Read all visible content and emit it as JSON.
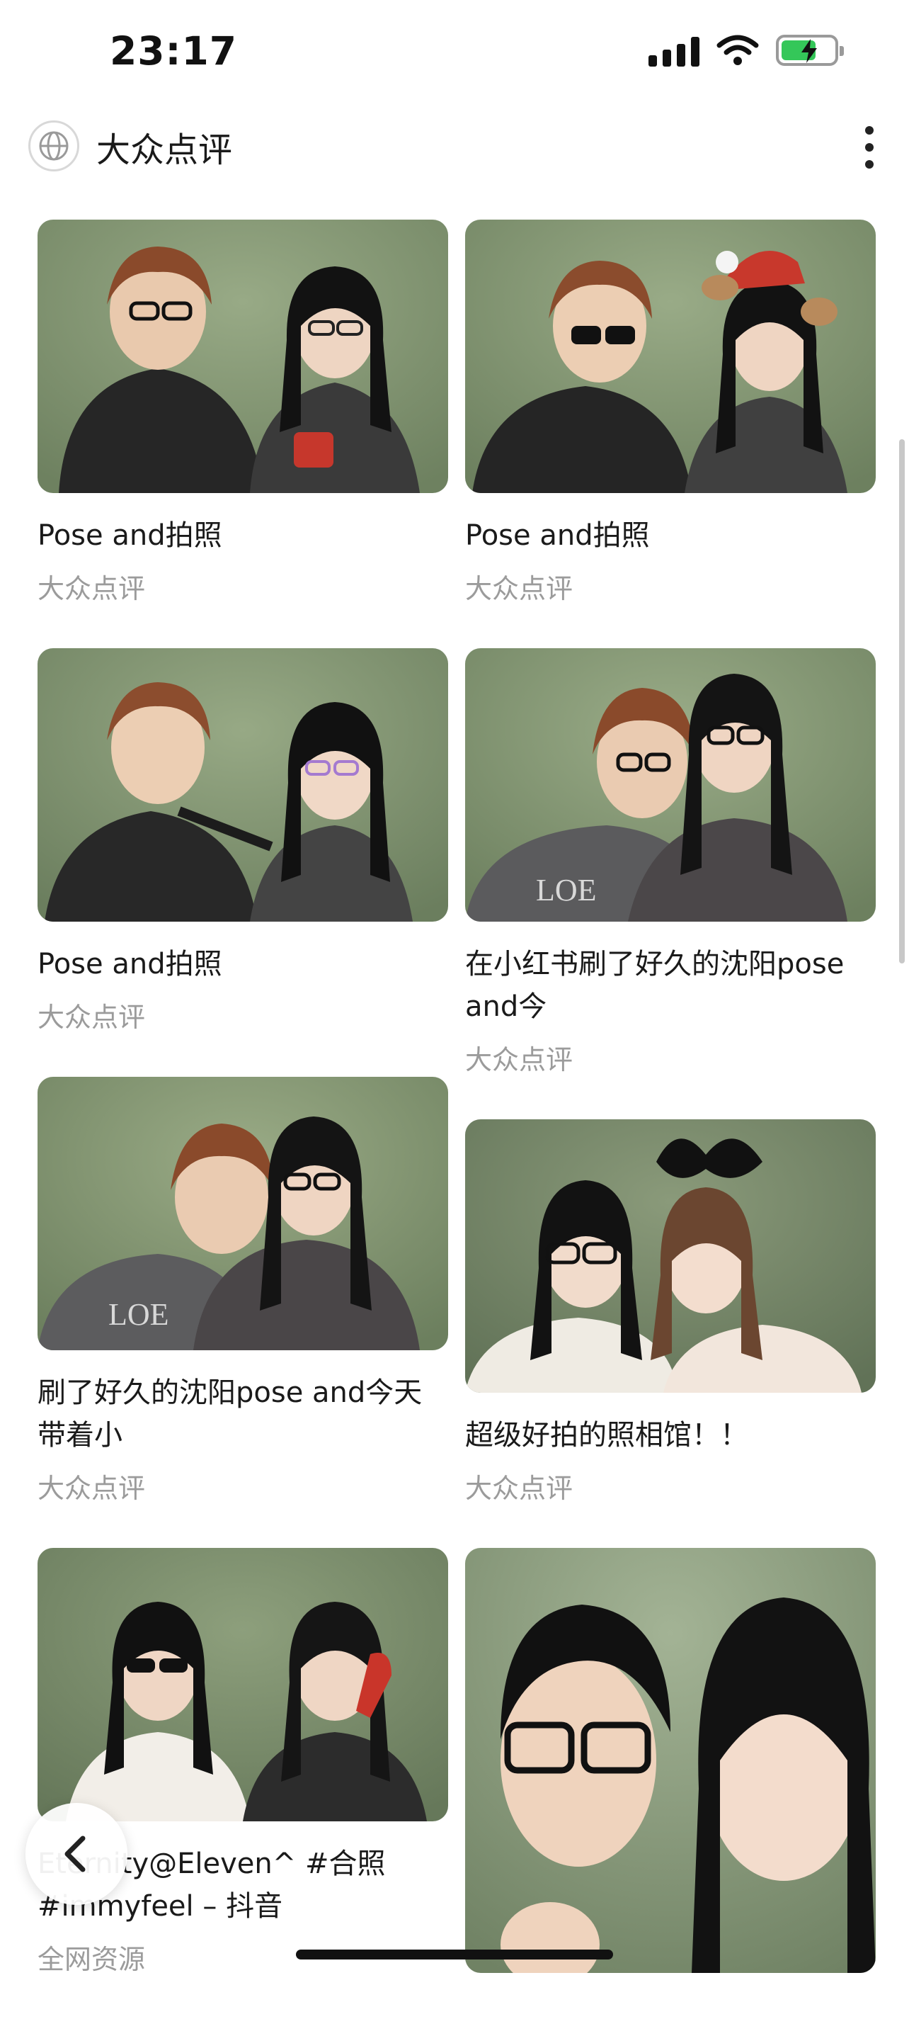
{
  "status_bar": {
    "time": "23:17"
  },
  "nav": {
    "title": "大众点评"
  },
  "feed": {
    "left": [
      {
        "title": "Pose and拍照",
        "source": "大众点评"
      },
      {
        "title": "Pose and拍照",
        "source": "大众点评"
      },
      {
        "title": "刷了好久的沈阳pose and今天带着小",
        "source": "大众点评"
      },
      {
        "title": "Eternity@Eleven^ #合照 #immyfeel – 抖音",
        "source": "全网资源"
      }
    ],
    "right": [
      {
        "title": "Pose and拍照",
        "source": "大众点评"
      },
      {
        "title": "在小红书刷了好久的沈阳pose and今",
        "source": "大众点评"
      },
      {
        "title": "超级好拍的照相馆！！",
        "source": "大众点评"
      }
    ]
  },
  "colors": {
    "photo_backdrop": "#7d906b",
    "battery": "#34c759",
    "muted_text": "#9b9b9b"
  }
}
